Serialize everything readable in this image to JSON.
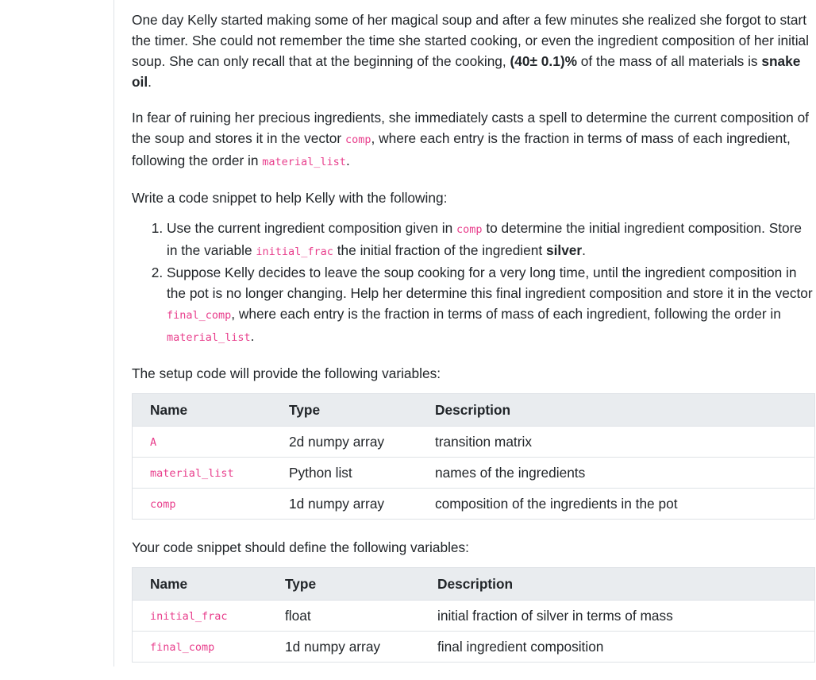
{
  "intro": {
    "p1_text": "One day Kelly started making some of her magical soup and after a few minutes she realized she forgot to start the timer. She could not remember the time she started cooking, or even the ingredient composition of her initial soup. She can only recall that at the beginning of the cooking, ",
    "p1_bold_pct": "(40± 0.1)%",
    "p1_mid": " of the mass of all materials is ",
    "p1_bold_oil": "snake oil",
    "p1_end": ".",
    "p2_a": "In fear of ruining her precious ingredients, she immediately casts a spell to determine the current composition of the soup and stores it in the vector ",
    "p2_code1": "comp",
    "p2_b": ", where each entry is the fraction in terms of mass of each ingredient, following the order in ",
    "p2_code2": "material_list",
    "p2_c": ".",
    "p3": "Write a code snippet to help Kelly with the following:"
  },
  "tasks": [
    {
      "a": "Use the current ingredient composition given in ",
      "code1": "comp",
      "b": " to determine the initial ingredient composition. Store in the variable ",
      "code2": "initial_frac",
      "c": " the initial fraction of the ingredient ",
      "bold": "silver",
      "d": "."
    },
    {
      "a": "Suppose Kelly decides to leave the soup cooking for a very long time, until the ingredient composition in the pot is no longer changing. Help her determine this final ingredient composition and store it in the vector ",
      "code1": "final_comp",
      "b": ", where each entry is the fraction in terms of mass of each ingredient, following the order in ",
      "code2": "material_list",
      "c": "."
    }
  ],
  "setup_heading": "The setup code will provide the following variables:",
  "setup_table": {
    "headers": [
      "Name",
      "Type",
      "Description"
    ],
    "rows": [
      [
        "A",
        "2d numpy array",
        "transition matrix"
      ],
      [
        "material_list",
        "Python list",
        "names of the ingredients"
      ],
      [
        "comp",
        "1d numpy array",
        "composition of the ingredients in the pot"
      ]
    ]
  },
  "define_heading": "Your code snippet should define the following variables:",
  "define_table": {
    "headers": [
      "Name",
      "Type",
      "Description"
    ],
    "rows": [
      [
        "initial_frac",
        "float",
        "initial fraction of silver in terms of mass"
      ],
      [
        "final_comp",
        "1d numpy array",
        "final ingredient composition"
      ]
    ]
  }
}
